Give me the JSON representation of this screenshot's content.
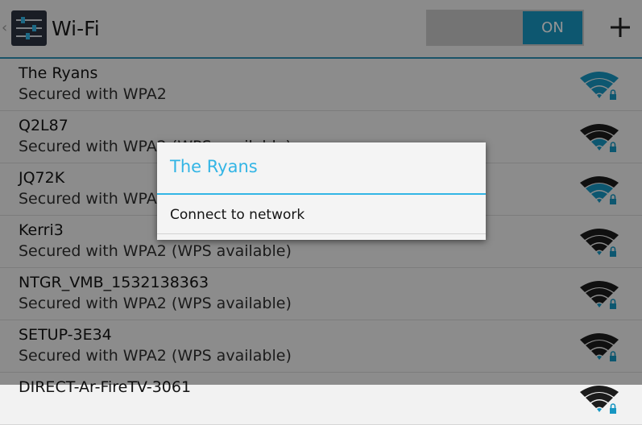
{
  "header": {
    "title": "Wi-Fi",
    "toggle_label": "ON",
    "toggle_state": "on",
    "add_icon": "plus-icon",
    "app_icon": "settings-sliders-icon"
  },
  "networks": [
    {
      "ssid": "The Ryans",
      "security": "Secured with WPA2",
      "signal_bars": 4
    },
    {
      "ssid": "Q2L87",
      "security": "Secured with WPA2 (WPS available)",
      "signal_bars": 2
    },
    {
      "ssid": "JQ72K",
      "security": "Secured with WPA2 (WPS available)",
      "signal_bars": 3
    },
    {
      "ssid": "Kerri3",
      "security": "Secured with WPA2 (WPS available)",
      "signal_bars": 1
    },
    {
      "ssid": "NTGR_VMB_1532138363",
      "security": "Secured with WPA2 (WPS available)",
      "signal_bars": 1
    },
    {
      "ssid": "SETUP-3E34",
      "security": "Secured with WPA2 (WPS available)",
      "signal_bars": 1
    },
    {
      "ssid": "DIRECT-Ar-FireTV-3061",
      "security": "",
      "signal_bars": 1
    }
  ],
  "dialog": {
    "title": "The Ryans",
    "items": [
      "Connect to network"
    ]
  },
  "colors": {
    "accent": "#33b5e5",
    "toggle_on": "#1796c2",
    "actionbar_line": "#2e8fb3"
  }
}
